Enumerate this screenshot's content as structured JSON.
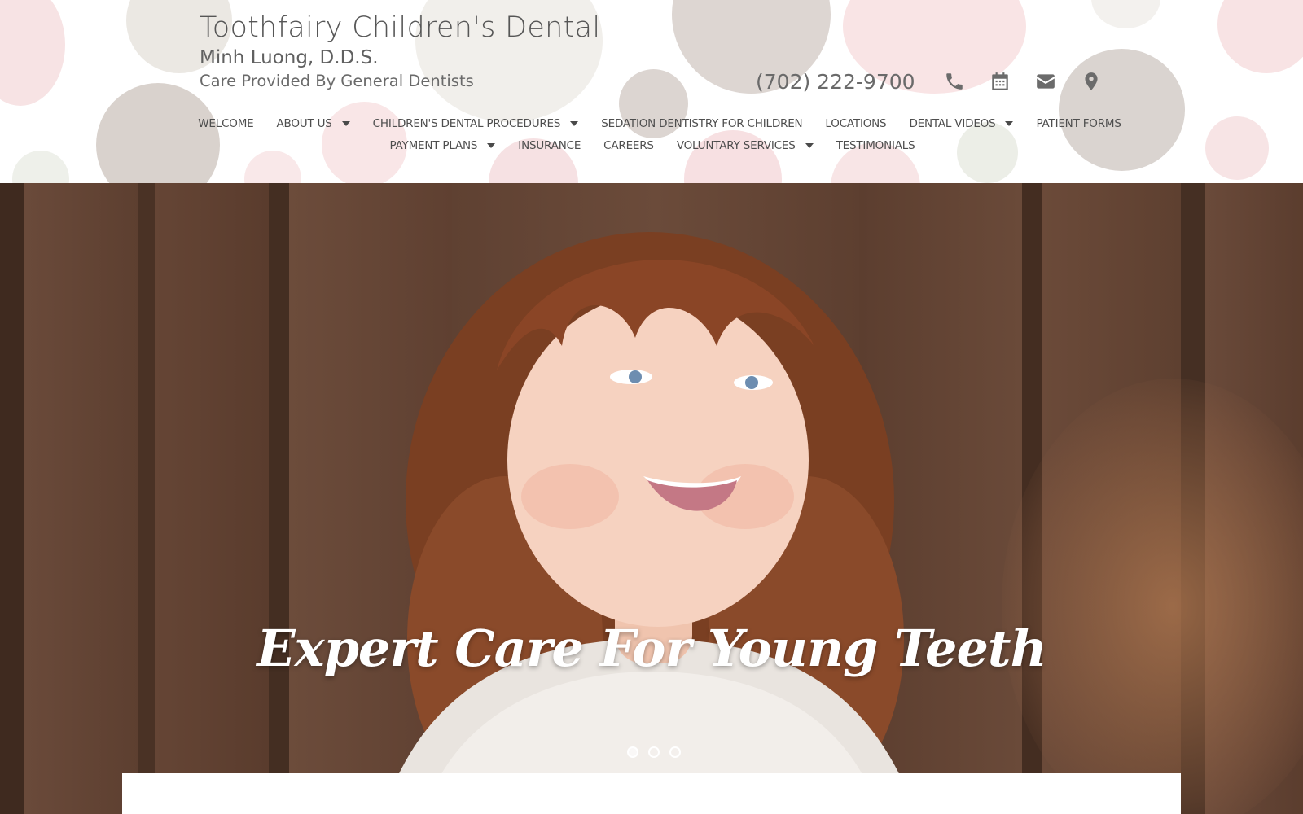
{
  "header": {
    "title": "Toothfairy Children's Dental",
    "doctor": "Minh Luong, D.D.S.",
    "tagline": "Care Provided By General Dentists",
    "phone": "(702) 222-9700",
    "contact_icons": [
      "phone-icon",
      "calendar-icon",
      "envelope-icon",
      "map-marker-icon"
    ]
  },
  "nav": {
    "row1": [
      {
        "label": "Welcome",
        "dropdown": false
      },
      {
        "label": "About Us",
        "dropdown": true
      },
      {
        "label": "Children's Dental Procedures",
        "dropdown": true
      },
      {
        "label": "Sedation Dentistry For Children",
        "dropdown": false
      },
      {
        "label": "Locations",
        "dropdown": false
      },
      {
        "label": "Dental Videos",
        "dropdown": true
      },
      {
        "label": "Patient Forms",
        "dropdown": false
      }
    ],
    "row2": [
      {
        "label": "Payment Plans",
        "dropdown": true
      },
      {
        "label": "Insurance",
        "dropdown": false
      },
      {
        "label": "Careers",
        "dropdown": false
      },
      {
        "label": "Voluntary Services",
        "dropdown": true
      },
      {
        "label": "Testimonials",
        "dropdown": false
      }
    ]
  },
  "hero": {
    "caption": "Expert Care For Young Teeth",
    "slides_total": 3,
    "active_slide": 1
  },
  "colors": {
    "nav_text": "#4e4e4e",
    "dot_pink": "#f6dfe1",
    "dot_taupe": "#d8d1cc",
    "hero_bg": "#5a3b2c"
  }
}
